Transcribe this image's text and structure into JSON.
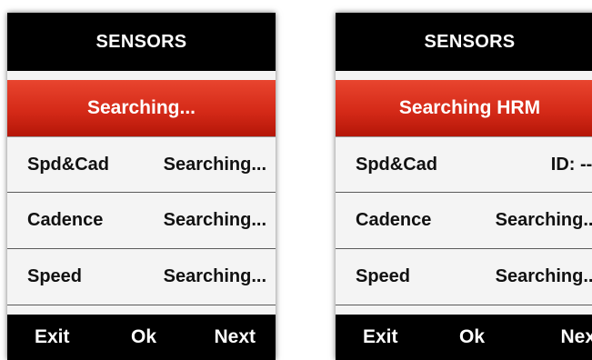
{
  "screens": [
    {
      "title": "SENSORS",
      "status": "Searching...",
      "rows": [
        {
          "label": "Spd&Cad",
          "value": "Searching..."
        },
        {
          "label": "Cadence",
          "value": "Searching..."
        },
        {
          "label": "Speed",
          "value": "Searching..."
        }
      ],
      "softkeys": {
        "exit": "Exit",
        "ok": "Ok",
        "next": "Next"
      }
    },
    {
      "title": "SENSORS",
      "status": "Searching HRM",
      "rows": [
        {
          "label": "Spd&Cad",
          "value": "ID: ---"
        },
        {
          "label": "Cadence",
          "value": "Searching..."
        },
        {
          "label": "Speed",
          "value": "Searching..."
        }
      ],
      "softkeys": {
        "exit": "Exit",
        "ok": "Ok",
        "next": "Next"
      }
    }
  ],
  "colors": {
    "status_bar": "#d52a18",
    "title_bar": "#000000",
    "list_background": "#f4f4f4"
  }
}
